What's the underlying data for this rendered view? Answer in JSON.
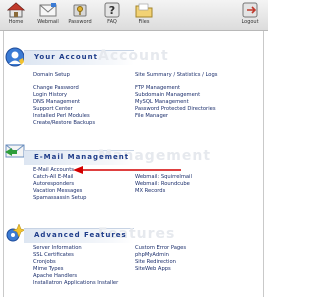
{
  "toolbar": {
    "items": [
      {
        "label": "Home",
        "icon": "home-icon"
      },
      {
        "label": "Webmail",
        "icon": "mail-icon"
      },
      {
        "label": "Password",
        "icon": "key-icon"
      },
      {
        "label": "FAQ",
        "icon": "question-icon"
      },
      {
        "label": "Files",
        "icon": "folder-icon"
      },
      {
        "label": "Logout",
        "icon": "logout-icon"
      }
    ]
  },
  "account": {
    "title": "Your Account",
    "ghost": "Account",
    "links_left": [
      "Domain Setup",
      "Change Password",
      "Login History",
      "DNS Management",
      "Support Center",
      "Installed Perl Modules",
      "Create/Restore Backups"
    ],
    "links_right": [
      "Site Summary / Statistics / Logs",
      "FTP Management",
      "Subdomain Management",
      "MySQL Management",
      "Password Protected Directories",
      "File Manager"
    ]
  },
  "email": {
    "title": "E-Mail Management",
    "ghost": "Management",
    "links_left": [
      "E-Mail Accounts",
      "Catch-All E-Mail",
      "Autoresponders",
      "Vacation Messages",
      "Spamassassin Setup"
    ],
    "links_right": [
      "Webmail: Squirrelmail",
      "Webmail: Roundcube",
      "MX Records"
    ]
  },
  "advanced": {
    "title": "Advanced Features",
    "ghost": "Features",
    "links_left": [
      "Server Information",
      "SSL Certificates",
      "Cronjobs",
      "Mime Types",
      "Apache Handlers",
      "Installatron Applications Installer"
    ],
    "links_right": [
      "Custom Error Pages",
      "phpMyAdmin",
      "Site Redirection",
      "SiteWeb Apps"
    ]
  },
  "colors": {
    "accent": "#1f3d8a",
    "arrow": "#d40000"
  }
}
